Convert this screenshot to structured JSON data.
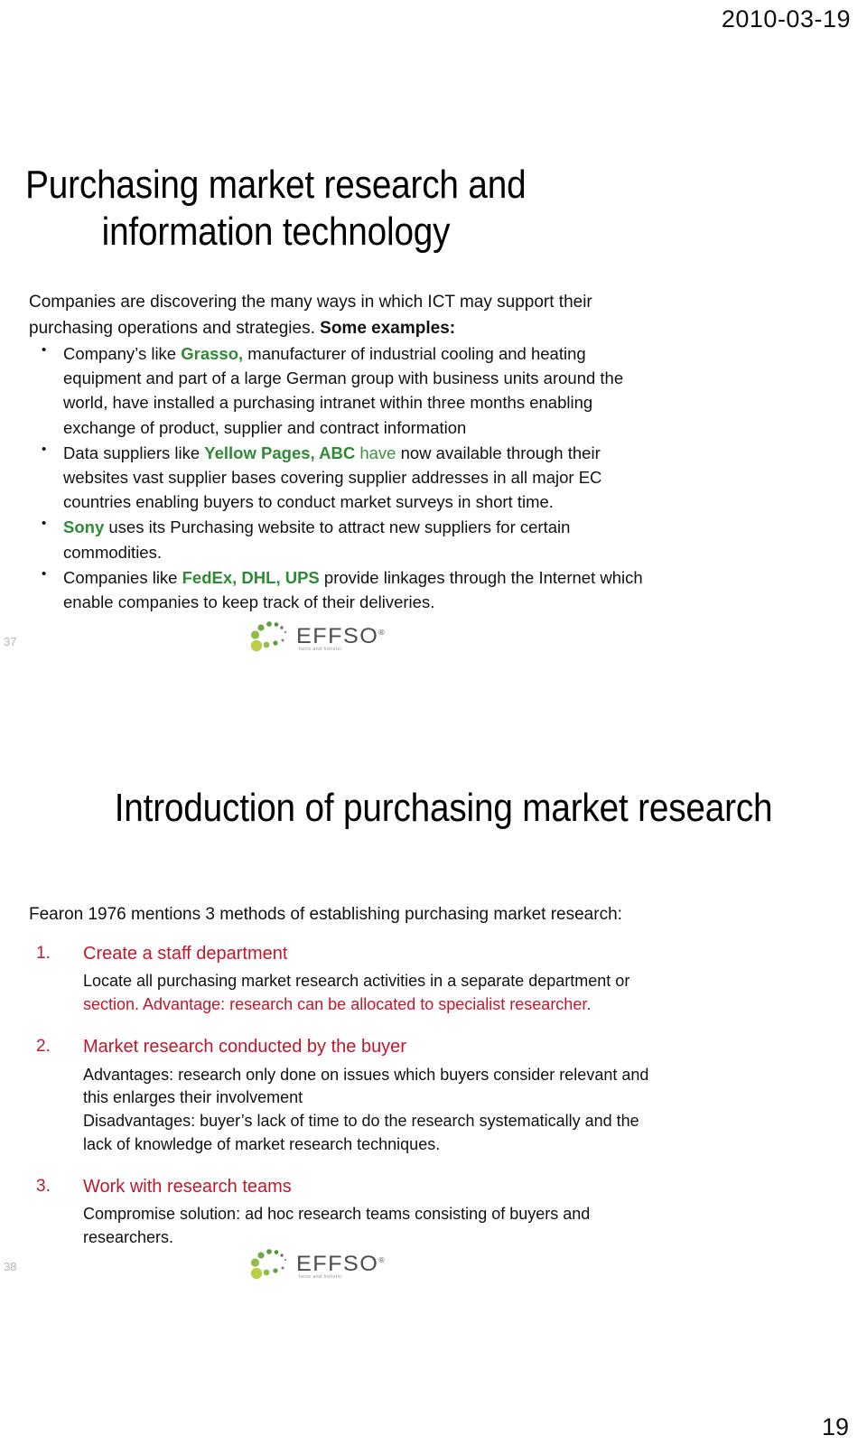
{
  "header": {
    "date": "2010-03-19"
  },
  "document": {
    "page_number": "19"
  },
  "slides": [
    {
      "number_label": "37",
      "title_line_1": "Purchasing market research and",
      "title_line_2": "information technology",
      "intro": {
        "text": "Companies are discovering the many ways in which ICT may support their purchasing operations and strategies. ",
        "emphasis": "Some examples:"
      },
      "bullets": [
        {
          "pre": "Company’s like ",
          "highlight": "Grasso,",
          "highlight_style": "green-bold",
          "post": " manufacturer of industrial cooling and heating equipment and part of a large German group with business units around the world, have installed a purchasing intranet within three months enabling exchange of product, supplier and contract information"
        },
        {
          "pre": "Data suppliers like ",
          "highlight": "Yellow Pages, ABC",
          "highlight_style": "green-bold",
          "highlight2": " have",
          "highlight2_style": "green",
          "post": " now available through their websites vast supplier bases covering supplier addresses in all major EC countries enabling buyers to conduct market surveys in short time."
        },
        {
          "pre": "",
          "highlight": "Sony",
          "highlight_style": "green-bold",
          "post": " uses its Purchasing website to attract new suppliers for certain commodities."
        },
        {
          "pre": "Companies like ",
          "highlight": "FedEx, DHL, UPS",
          "highlight_style": "green-bold",
          "post": " provide linkages through the Internet which enable companies to keep track of their deliveries."
        }
      ],
      "logo": {
        "wordmark": "EFFSO",
        "registered_mark": "®",
        "tagline": "facts and holistic"
      }
    },
    {
      "number_label": "38",
      "title_line_1": "Introduction of purchasing market",
      "title_line_2": "research",
      "lead": "Fearon 1976 mentions 3 methods of establishing purchasing market research:",
      "items": [
        {
          "num": "1.",
          "head": "Create a staff department",
          "body_black": "Locate all purchasing market research activities in a separate department or ",
          "body_red": "section. Advantage: research can be allocated to specialist researcher."
        },
        {
          "num": "2.",
          "head": "Market research conducted by the buyer",
          "body_black": "Advantages: research only done on issues which buyers consider relevant and this enlarges their involvement\nDisadvantages: buyer’s lack of time to do the research systematically and the lack of knowledge of market research techniques.",
          "body_red": ""
        },
        {
          "num": "3.",
          "head": "Work with research teams",
          "body_black": "Compromise solution: ad hoc research teams consisting of buyers and researchers.",
          "body_red": ""
        }
      ],
      "logo": {
        "wordmark": "EFFSO",
        "registered_mark": "®",
        "tagline": "facts and holistic"
      }
    }
  ],
  "colors": {
    "accent_green": "#2f8a33",
    "accent_red": "#c0172a",
    "text": "#111111",
    "page_num_gray": "#b6b6b6"
  }
}
